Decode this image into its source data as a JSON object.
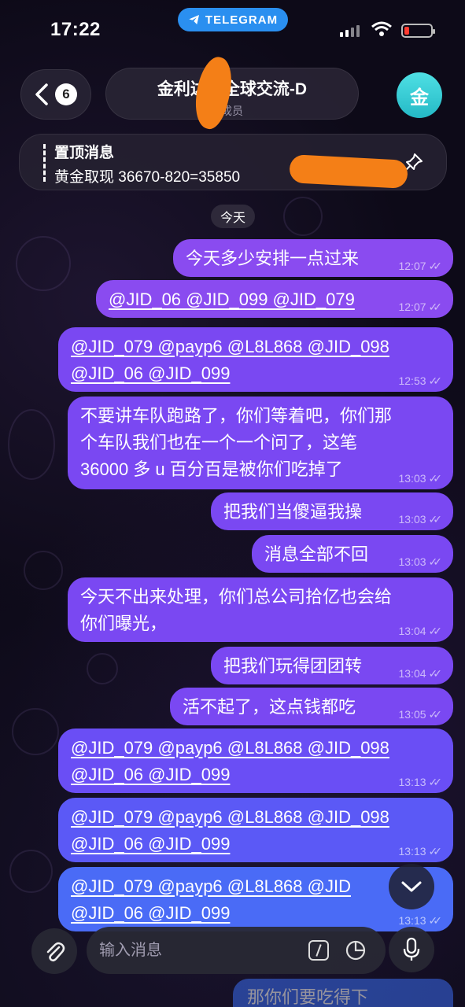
{
  "status_bar": {
    "time": "17:22",
    "app_pill": "TELEGRAM"
  },
  "header": {
    "back_count": "6",
    "title": "金利达&      全球交流-D",
    "subtitle": "成员",
    "avatar_letter": "金"
  },
  "pinned": {
    "heading": "置顶消息",
    "text": "黄金取现 36670-820=35850"
  },
  "date_chip": "今天",
  "messages": [
    {
      "text": "今天多少安排一点过来",
      "time": "12:07"
    },
    {
      "text": "@JID_06 @JID_099 @JID_079",
      "time": "12:07"
    },
    {
      "line1": "@JID_079 @payp6 @L8L868 @JID_098",
      "line2": "@JID_06 @JID_099",
      "time": "12:53"
    },
    {
      "line1": "不要讲车队跑路了，你们等着吧，你们那",
      "line2": "个车队我们也在一个一个问了，这笔",
      "line3": "36000 多 u 百分百是被你们吃掉了",
      "time": "13:03"
    },
    {
      "text": "把我们当傻逼我操",
      "time": "13:03"
    },
    {
      "text": "消息全部不回",
      "time": "13:03"
    },
    {
      "line1": "今天不出来处理，你们总公司拾亿也会给",
      "line2": "你们曝光，",
      "time": "13:04"
    },
    {
      "text": "把我们玩得团团转",
      "time": "13:04"
    },
    {
      "text": "活不起了，这点钱都吃",
      "time": "13:05"
    },
    {
      "line1": "@JID_079 @payp6 @L8L868 @JID_098",
      "line2": "@JID_06 @JID_099",
      "time": "13:13"
    },
    {
      "line1": "@JID_079 @payp6 @L8L868 @JID_098",
      "line2": "@JID_06 @JID_099",
      "time": "13:13"
    },
    {
      "line1": "@JID_079 @payp6 @L8L868 @JID",
      "line2": "@JID_06 @JID_099",
      "time": "13:13"
    }
  ],
  "composer": {
    "placeholder": "输入消息",
    "peek_text": "那你们要吃得下"
  },
  "icons": {
    "back": "chevron-left-icon",
    "telegram": "telegram-plane-icon",
    "pin": "pin-icon",
    "attach": "paperclip-icon",
    "command": "slash-command-icon",
    "sticker": "sticker-icon",
    "mic": "microphone-icon",
    "scroll": "chevron-down-icon",
    "read": "double-check-icon"
  }
}
